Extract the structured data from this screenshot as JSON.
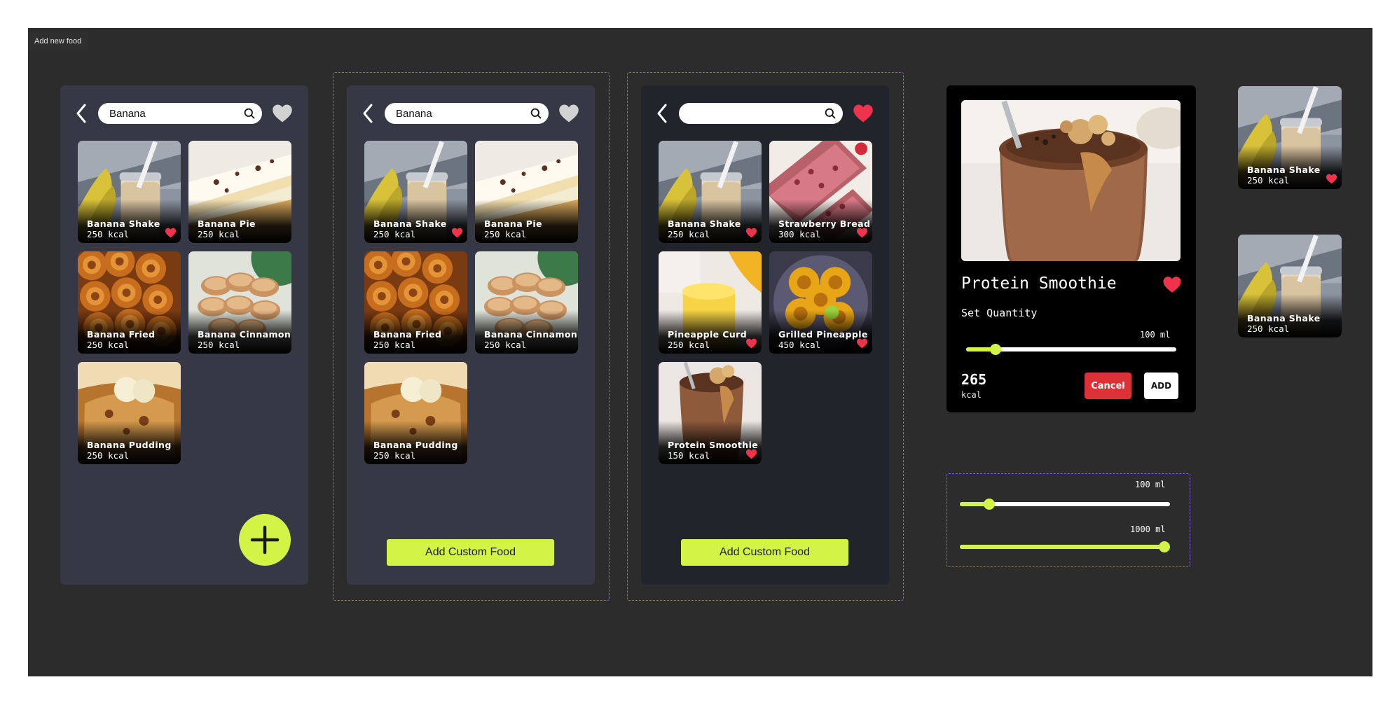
{
  "frame": {
    "label": "Add new food"
  },
  "colors": {
    "canvas": "#2c2c2c",
    "screen": "#363945",
    "screen_dark": "#22242c",
    "accent": "#d4f347",
    "heart": "#f0334d",
    "heart_inactive": "#d2d2d2",
    "cancel": "#dc3137",
    "variant_border": "#8b5cf6"
  },
  "screens": [
    {
      "search": {
        "value": "Banana",
        "placeholder": ""
      },
      "favorites_active": false,
      "items": [
        {
          "name": "Banana Shake",
          "kcal": "250 kcal",
          "favorite": true
        },
        {
          "name": "Banana Pie",
          "kcal": "250 kcal",
          "favorite": false
        },
        {
          "name": "Banana Fried",
          "kcal": "250 kcal",
          "favorite": false
        },
        {
          "name": "Banana Cinnamon",
          "kcal": "250 kcal",
          "favorite": false
        },
        {
          "name": "Banana Pudding",
          "kcal": "250 kcal",
          "favorite": false
        }
      ],
      "action": {
        "type": "fab",
        "icon": "plus-icon"
      }
    },
    {
      "search": {
        "value": "Banana",
        "placeholder": ""
      },
      "favorites_active": false,
      "items": [
        {
          "name": "Banana Shake",
          "kcal": "250 kcal",
          "favorite": true
        },
        {
          "name": "Banana Pie",
          "kcal": "250 kcal",
          "favorite": false
        },
        {
          "name": "Banana Fried",
          "kcal": "250 kcal",
          "favorite": false
        },
        {
          "name": "Banana Cinnamon",
          "kcal": "250 kcal",
          "favorite": false
        },
        {
          "name": "Banana Pudding",
          "kcal": "250 kcal",
          "favorite": false
        }
      ],
      "action": {
        "type": "button",
        "label": "Add Custom Food"
      }
    },
    {
      "search": {
        "value": "",
        "placeholder": ""
      },
      "favorites_active": true,
      "items": [
        {
          "name": "Banana Shake",
          "kcal": "250 kcal",
          "favorite": true
        },
        {
          "name": "Strawberry Bread",
          "kcal": "300 kcal",
          "favorite": true
        },
        {
          "name": "Pineapple Curd",
          "kcal": "250 kcal",
          "favorite": true
        },
        {
          "name": "Grilled Pineapple",
          "kcal": "450 kcal",
          "favorite": true
        },
        {
          "name": "Protein Smoothie",
          "kcal": "150 kcal",
          "favorite": true
        }
      ],
      "action": {
        "type": "button",
        "label": "Add Custom Food"
      }
    }
  ],
  "detail": {
    "title": "Protein Smoothie",
    "favorite": true,
    "set_quantity_label": "Set Quantity",
    "quantity_label": "100 ml",
    "slider_fraction": 0.14,
    "total": "265",
    "unit": "kcal",
    "cancel_label": "Cancel",
    "add_label": "ADD"
  },
  "slider_states": [
    {
      "label": "100 ml",
      "fraction": 0.14
    },
    {
      "label": "1000 ml",
      "fraction": 1.0
    }
  ],
  "mini_cards": [
    {
      "name": "Banana Shake",
      "kcal": "250 kcal",
      "favorite": true
    },
    {
      "name": "Banana Shake",
      "kcal": "250 kcal",
      "favorite": false
    }
  ],
  "icons": {
    "back": "chevron-left-icon",
    "search": "search-icon",
    "favorite": "heart-icon",
    "add": "plus-icon"
  }
}
